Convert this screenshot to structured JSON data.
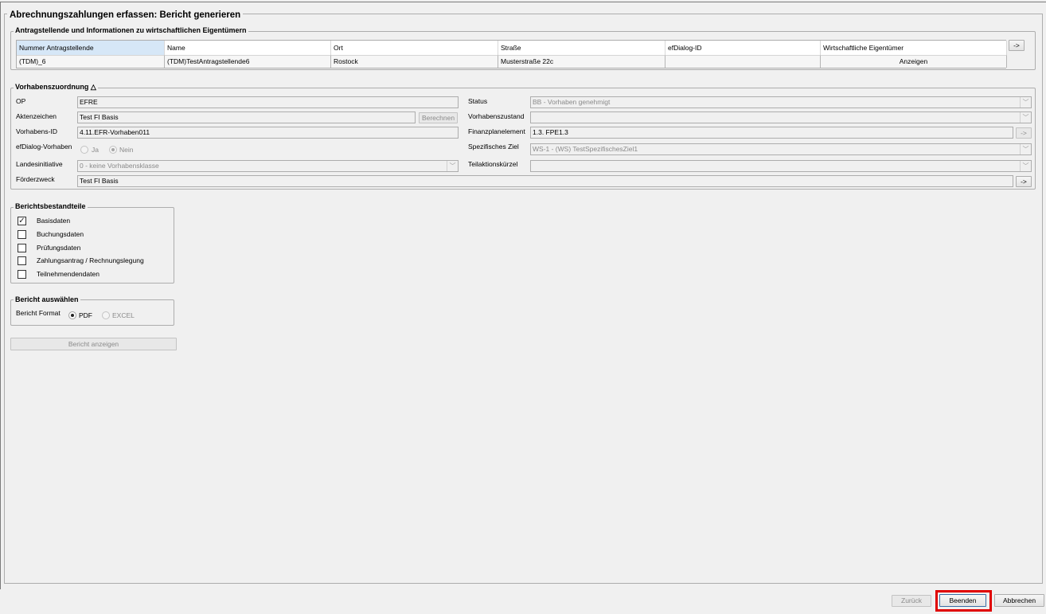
{
  "window": {
    "title": "Abrechnungszahlungen erfassen: Bericht generieren"
  },
  "applicants": {
    "title": "Antragstellende und Informationen zu wirtschaftlichen Eigentümern",
    "nav_button": "->",
    "columns": [
      "Nummer Antragstellende",
      "Name",
      "Ort",
      "Straße",
      "efDialog-ID",
      "Wirtschaftliche Eigentümer"
    ],
    "rows": [
      [
        "(TDM)_6",
        "(TDM)TestAntragstellende6",
        "Rostock",
        "Musterstraße 22c",
        "",
        "Anzeigen"
      ]
    ]
  },
  "project": {
    "title": "Vorhabenszuordnung △",
    "op_label": "OP",
    "op_value": "EFRE",
    "aktenzeichen_label": "Aktenzeichen",
    "aktenzeichen_value": "Test FI Basis",
    "berechnen_button": "Berechnen",
    "vorhabens_id_label": "Vorhabens-ID",
    "vorhabens_id_value": "4.11.EFR-Vorhaben011",
    "efdialog_label": "efDialog-Vorhaben",
    "efdialog_yes": "Ja",
    "efdialog_no": "Nein",
    "landesinitiative_label": "Landesinitiative",
    "landesinitiative_value": "0 - keine Vorhabensklasse",
    "foerderzweck_label": "Förderzweck",
    "foerderzweck_value": "Test FI Basis",
    "foerderzweck_button": "->",
    "status_label": "Status",
    "status_value": "BB - Vorhaben genehmigt",
    "vorhabenszustand_label": "Vorhabenszustand",
    "vorhabenszustand_value": "",
    "finanzplanelement_label": "Finanzplanelement",
    "finanzplanelement_value": "1.3. FPE1.3",
    "finanzplanelement_button": "->",
    "spezifisches_ziel_label": "Spezifisches Ziel",
    "spezifisches_ziel_value": "WS-1 - (WS) TestSpezifischesZiel1",
    "teilaktion_label": "Teilaktionskürzel",
    "teilaktion_value": ""
  },
  "components": {
    "title": "Berichtsbestandteile",
    "items": [
      {
        "label": "Basisdaten",
        "checked": true
      },
      {
        "label": "Buchungsdaten",
        "checked": false
      },
      {
        "label": "Prüfungsdaten",
        "checked": false
      },
      {
        "label": "Zahlungsantrag / Rechnungslegung",
        "checked": false
      },
      {
        "label": "Teilnehmendendaten",
        "checked": false
      }
    ],
    "check_mark": "✓"
  },
  "report": {
    "title": "Bericht auswählen",
    "format_label": "Bericht Format",
    "pdf_label": "PDF",
    "excel_label": "EXCEL",
    "show_button": "Bericht anzeigen"
  },
  "footer": {
    "back_button": "Zurück",
    "finish_button": "Beenden",
    "cancel_button": "Abbrechen"
  },
  "colors": {
    "highlight": "#e00000",
    "selected_header": "#d6e7f7"
  }
}
